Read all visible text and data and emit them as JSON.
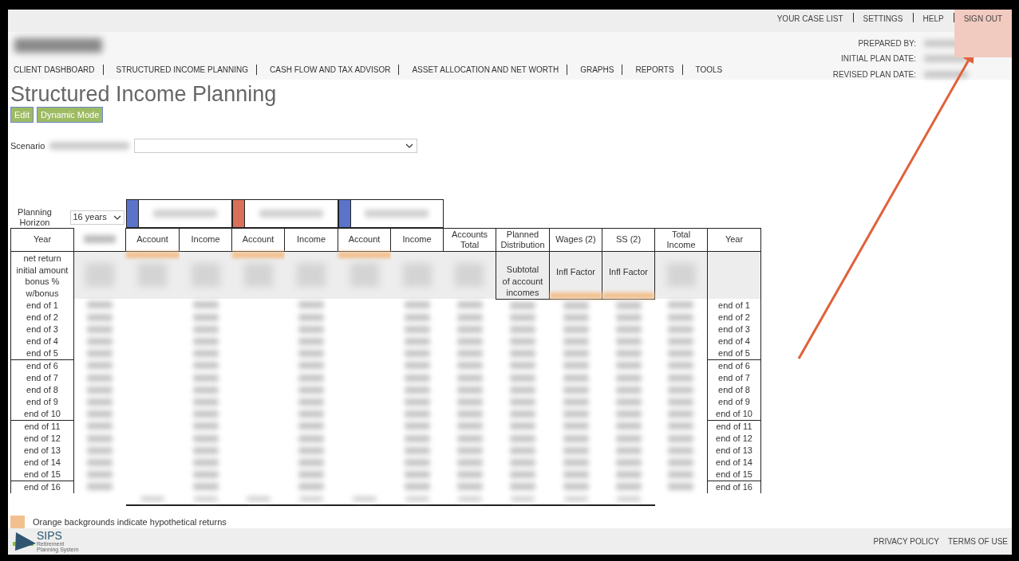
{
  "top_links": [
    {
      "label": "YOUR CASE LIST",
      "highlighted": false
    },
    {
      "label": "SETTINGS",
      "highlighted": false
    },
    {
      "label": "HELP",
      "highlighted": false
    },
    {
      "label": "SIGN OUT",
      "highlighted": true
    }
  ],
  "nav": [
    {
      "label": "CLIENT DASHBOARD",
      "selected": false
    },
    {
      "label": "STRUCTURED INCOME PLANNING",
      "selected": false
    },
    {
      "label": "CASH FLOW AND TAX ADVISOR",
      "selected": false
    },
    {
      "label": "ASSET ALLOCATION AND NET WORTH",
      "selected": false
    },
    {
      "label": "GRAPHS",
      "selected": false
    },
    {
      "label": "REPORTS",
      "selected": false
    },
    {
      "label": "TOOLS",
      "selected": false
    }
  ],
  "plan_info": [
    {
      "label": "PREPARED BY:"
    },
    {
      "label": "INITIAL PLAN DATE:"
    },
    {
      "label": "REVISED PLAN DATE:"
    }
  ],
  "title": "Structured Income Planning",
  "buttons": [
    "Edit",
    "Dynamic Mode"
  ],
  "scenario": {
    "label": "Scenario"
  },
  "planning_horizon": {
    "label": "Planning Horizon",
    "value": "16 years"
  },
  "accounts": [
    {
      "color": "#5b74c9"
    },
    {
      "color": "#d9715a"
    },
    {
      "color": "#5b74c9"
    }
  ],
  "table": {
    "columns": [
      {
        "header": "Year",
        "info": [
          "net return",
          "initial amount",
          "bonus %",
          "w/bonus"
        ]
      },
      {
        "kind": "redacted"
      },
      {
        "header": "Account",
        "hypothetical": true
      },
      {
        "header": "Income"
      },
      {
        "header": "Account",
        "hypothetical": true
      },
      {
        "header": "Income"
      },
      {
        "header": "Account",
        "hypothetical": true
      },
      {
        "header": "Income"
      },
      {
        "header": "Accounts Total"
      },
      {
        "header": "Planned Distribution",
        "info": [
          "Subtotal",
          "of account",
          "incomes"
        ]
      },
      {
        "header": "Wages (2)",
        "info": [
          "Infl Factor"
        ],
        "hypothetical": true
      },
      {
        "header": "SS (2)",
        "info": [
          "Infl Factor"
        ],
        "hypothetical": true
      },
      {
        "header": "Total Income"
      },
      {
        "header": "Year"
      }
    ],
    "rows": [
      {
        "year_left": "end of 1",
        "year_right": "end of 1"
      },
      {
        "year_left": "end of 2",
        "year_right": "end of 2"
      },
      {
        "year_left": "end of 3",
        "year_right": "end of 3"
      },
      {
        "year_left": "end of 4",
        "year_right": "end of 4"
      },
      {
        "year_left": "end of 5",
        "year_right": "end of 5"
      },
      {
        "year_left": "end of 6",
        "year_right": "end of 6"
      },
      {
        "year_left": "end of 7",
        "year_right": "end of 7"
      },
      {
        "year_left": "end of 8",
        "year_right": "end of 8"
      },
      {
        "year_left": "end of 9",
        "year_right": "end of 9"
      },
      {
        "year_left": "end of 10",
        "year_right": "end of 10"
      },
      {
        "year_left": "end of 11",
        "year_right": "end of 11"
      },
      {
        "year_left": "end of 12",
        "year_right": "end of 12"
      },
      {
        "year_left": "end of 13",
        "year_right": "end of 13"
      },
      {
        "year_left": "end of 14",
        "year_right": "end of 14"
      },
      {
        "year_left": "end of 15",
        "year_right": "end of 15"
      },
      {
        "year_left": "end of 16",
        "year_right": "end of 16"
      }
    ]
  },
  "legend": {
    "color": "#f2c08e",
    "text": "Orange backgrounds indicate hypothetical returns"
  },
  "logo": {
    "name": "SIPS",
    "tagline": "Retirement Planning System"
  },
  "footer_links": [
    "PRIVACY POLICY",
    "TERMS OF USE"
  ]
}
